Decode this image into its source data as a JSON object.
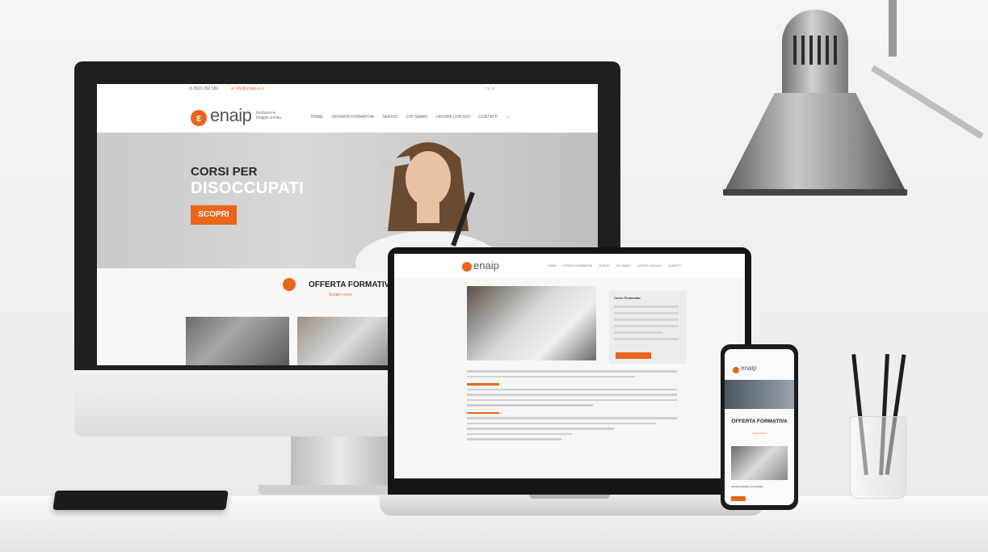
{
  "desktop": {
    "topbar": {
      "phone": "0522 292 550",
      "email": "info@enaip.re.it",
      "social": "f  ◎  in"
    },
    "logo": {
      "mark": "ε",
      "word": "enaip",
      "tagline": "fondazione Reggio Emilia"
    },
    "menu": [
      "HOME",
      "OFFERTA FORMATIVA",
      "SERVIZI",
      "CHI SIAMO",
      "LAVORA CON NOI",
      "CONTATTI"
    ],
    "hero": {
      "line1": "CORSI PER",
      "line2": "DISOCCUPATI",
      "button": "SCOPRI"
    },
    "offer": {
      "title": "OFFERTA FORMATIVA",
      "subtitle": "Scopri i corsi"
    }
  },
  "laptop": {
    "logo": {
      "word": "enaip"
    },
    "menu": [
      "HOME",
      "OFFERTA FORMATIVA",
      "SERVIZI",
      "CHI SIAMO",
      "LAVORA CON NOI",
      "CONTATTI"
    ],
    "card": {
      "title": "Corso Financiato"
    }
  },
  "phone": {
    "logo": {
      "word": "enaip"
    },
    "title": "OFFERTA FORMATIVA",
    "subtitle": "Scopri i corsi",
    "caption": "Operatore grafico e di stampa"
  },
  "colors": {
    "accent": "#e8651a",
    "dark": "#1f1f1f"
  },
  "icons": [
    "phone-icon",
    "mail-icon",
    "search-icon",
    "logo-mark-icon"
  ]
}
